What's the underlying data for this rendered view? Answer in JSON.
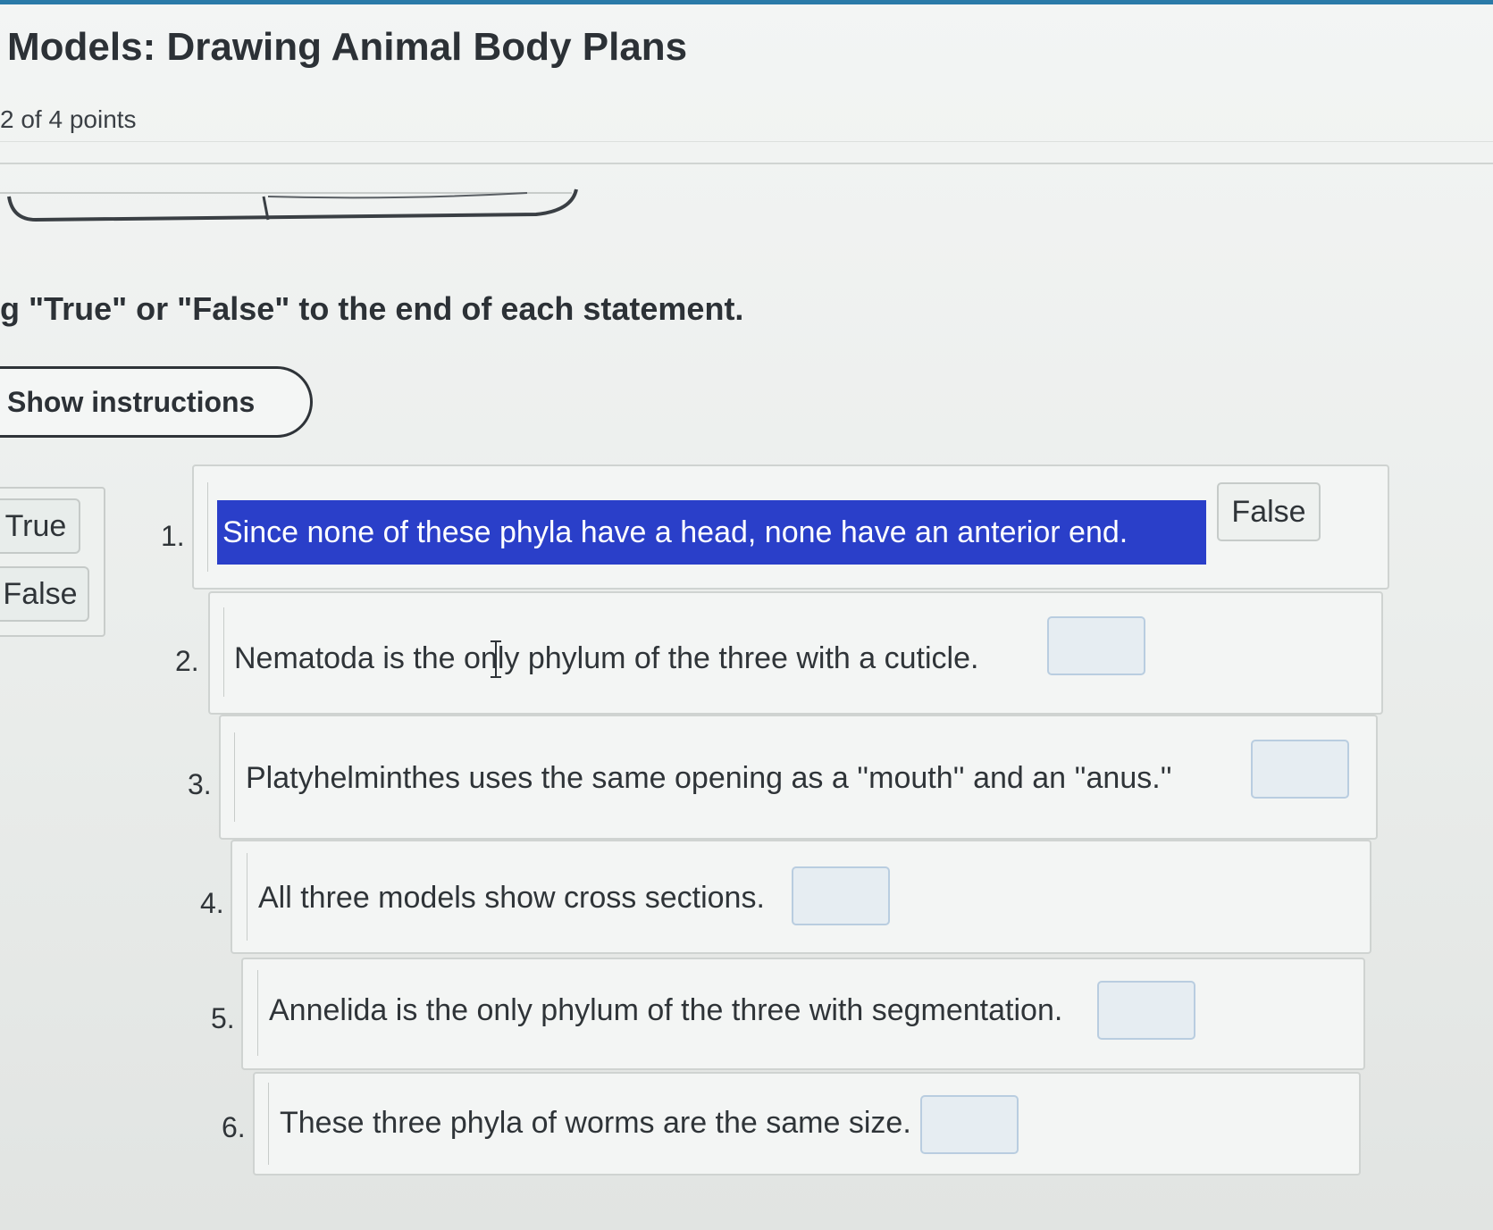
{
  "header": {
    "title": "Models: Drawing Animal Body Plans",
    "points": "2 of 4 points"
  },
  "activity": {
    "instruction": "g \"True\" or \"False\" to the end of each statement.",
    "show_instructions_label": "Show instructions"
  },
  "word_bank": {
    "items": [
      "True",
      "False"
    ]
  },
  "questions": [
    {
      "number": "1.",
      "text": "Since none of these phyla have a head, none have an anterior end.",
      "answer": "False",
      "selected": true
    },
    {
      "number": "2.",
      "text": "Nematoda is the only phylum of the three with a cuticle.",
      "answer": ""
    },
    {
      "number": "3.",
      "text": "Platyhelminthes uses the same opening as a ''mouth'' and an ''anus.''",
      "answer": ""
    },
    {
      "number": "4.",
      "text": "All three models show cross sections.",
      "answer": ""
    },
    {
      "number": "5.",
      "text": "Annelida is the only phylum of the three with segmentation.",
      "answer": ""
    },
    {
      "number": "6.",
      "text": "These three phyla of worms are the same size.",
      "answer": ""
    }
  ],
  "colors": {
    "selection": "#2a3fc9",
    "accent": "#2a7aa8",
    "drop_target_border": "#b9cde0"
  }
}
